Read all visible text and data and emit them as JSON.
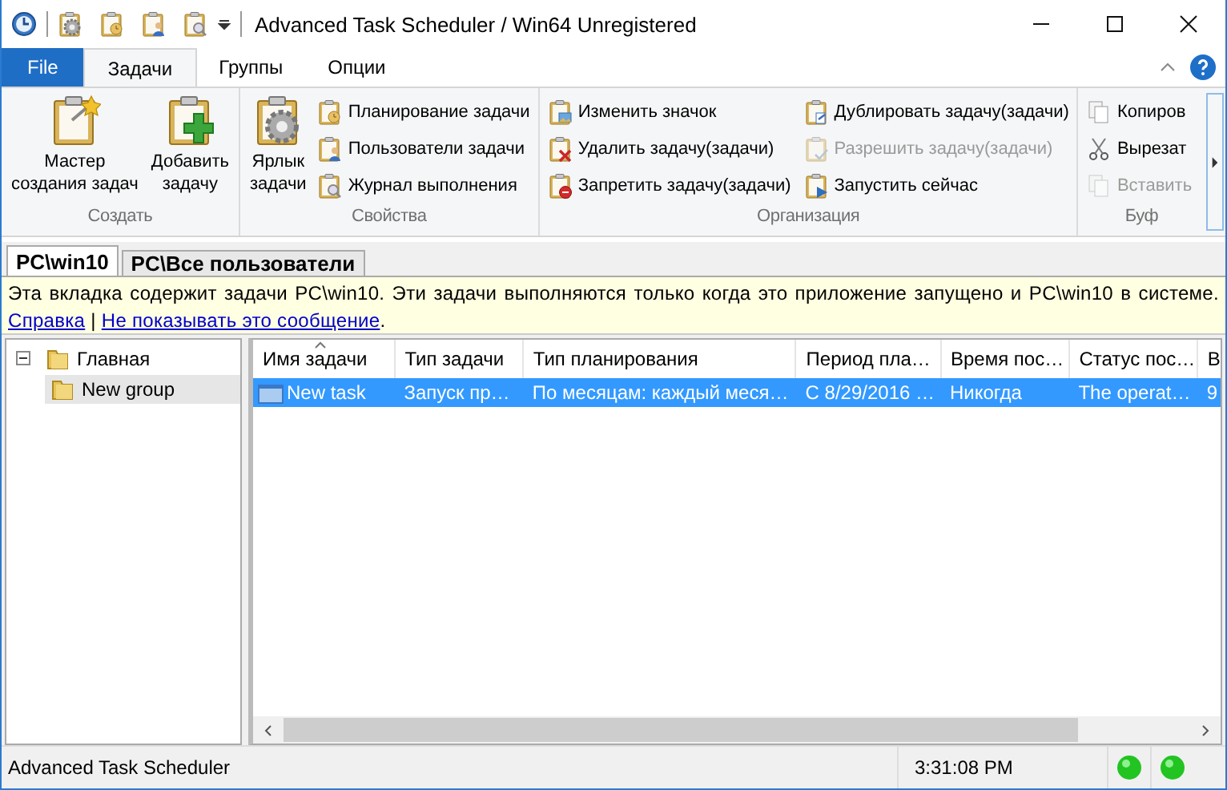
{
  "window": {
    "title": "Advanced Task Scheduler / Win64 Unregistered"
  },
  "ribbon_tabs": [
    {
      "label": "File",
      "kind": "file",
      "selected": false
    },
    {
      "label": "Задачи",
      "kind": "tab",
      "selected": true
    },
    {
      "label": "Группы",
      "kind": "tab",
      "selected": false
    },
    {
      "label": "Опции",
      "kind": "tab",
      "selected": false
    }
  ],
  "ribbon_groups": [
    {
      "label": "Создать",
      "large": [
        {
          "label": "Мастер\nсоздания задач"
        },
        {
          "label": "Добавить\nзадачу"
        }
      ]
    },
    {
      "label": "Свойства",
      "large": [
        {
          "label": "Ярлык\nзадачи"
        }
      ],
      "small": [
        {
          "label": "Планирование задачи",
          "disabled": false
        },
        {
          "label": "Пользователи задачи",
          "disabled": false
        },
        {
          "label": "Журнал выполнения",
          "disabled": false
        }
      ]
    },
    {
      "label": "Организация",
      "small": [
        {
          "label": "Изменить значок",
          "disabled": false
        },
        {
          "label": "Удалить задачу(задачи)",
          "disabled": false
        },
        {
          "label": "Запретить задачу(задачи)",
          "disabled": false
        },
        {
          "label": "Дублировать задачу(задачи)",
          "disabled": false
        },
        {
          "label": "Разрешить задачу(задачи)",
          "disabled": true
        },
        {
          "label": "Запустить сейчас",
          "disabled": false
        }
      ]
    },
    {
      "label": "Буф",
      "small": [
        {
          "label": "Копиров",
          "disabled": false
        },
        {
          "label": "Вырезат",
          "disabled": false
        },
        {
          "label": "Вставить",
          "disabled": true
        }
      ]
    }
  ],
  "doc_tabs": [
    {
      "label": "PC\\win10",
      "selected": true
    },
    {
      "label": "PC\\Все пользователи",
      "selected": false
    }
  ],
  "info_bar": {
    "text": "Эта вкладка содержит задачи PC\\win10. Эти задачи выполняются только когда это приложение запущено и PC\\win10 в системе.",
    "links": [
      "Справка",
      "Не показывать это сообщение"
    ],
    "separator": "|",
    "end": "."
  },
  "tree": [
    {
      "label": "Главная",
      "expanded": true,
      "selected": false,
      "children": [
        {
          "label": "New group",
          "selected": true
        }
      ]
    }
  ],
  "table": {
    "columns": [
      "Имя задачи",
      "Тип задачи",
      "Тип планирования",
      "Период пла…",
      "Время пос…",
      "Статус пос…",
      "В"
    ],
    "rows": [
      {
        "selected": true,
        "cells": [
          "New task",
          "Запуск пр…",
          "По месяцам: каждый меся…",
          "С 8/29/2016 …",
          "Никогда",
          "The operat…",
          "9"
        ]
      }
    ]
  },
  "status_bar": {
    "text": "Advanced Task Scheduler",
    "time": "3:31:08 PM"
  }
}
